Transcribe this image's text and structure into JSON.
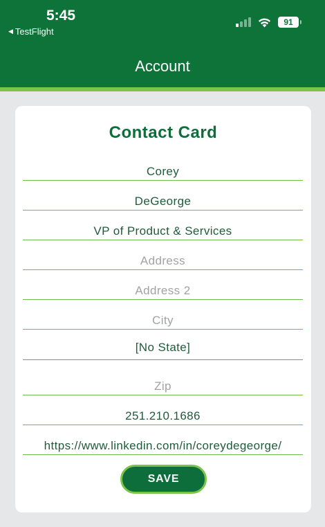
{
  "status_bar": {
    "time": "5:45",
    "back_app": "TestFlight",
    "battery": "91",
    "signal_bars_active": 1,
    "wifi": true
  },
  "header": {
    "title": "Account"
  },
  "card": {
    "title": "Contact Card",
    "fields": {
      "first_name": {
        "value": "Corey"
      },
      "last_name": {
        "value": "DeGeorge"
      },
      "title": {
        "value": "VP of Product & Services"
      },
      "address": {
        "placeholder": "Address"
      },
      "address2": {
        "placeholder": "Address 2"
      },
      "city": {
        "placeholder": "City"
      },
      "state": {
        "value": "[No State]"
      },
      "zip": {
        "placeholder": "Zip"
      },
      "phone": {
        "value": "251.210.1686"
      },
      "linkedin": {
        "value": "https://www.linkedin.com/in/coreydegeorge/"
      }
    },
    "save_label": "SAVE"
  },
  "colors": {
    "header": "#0e7339",
    "accent": "#7cc34a",
    "text": "#1f5b3a",
    "background": "#e6e7e9"
  }
}
